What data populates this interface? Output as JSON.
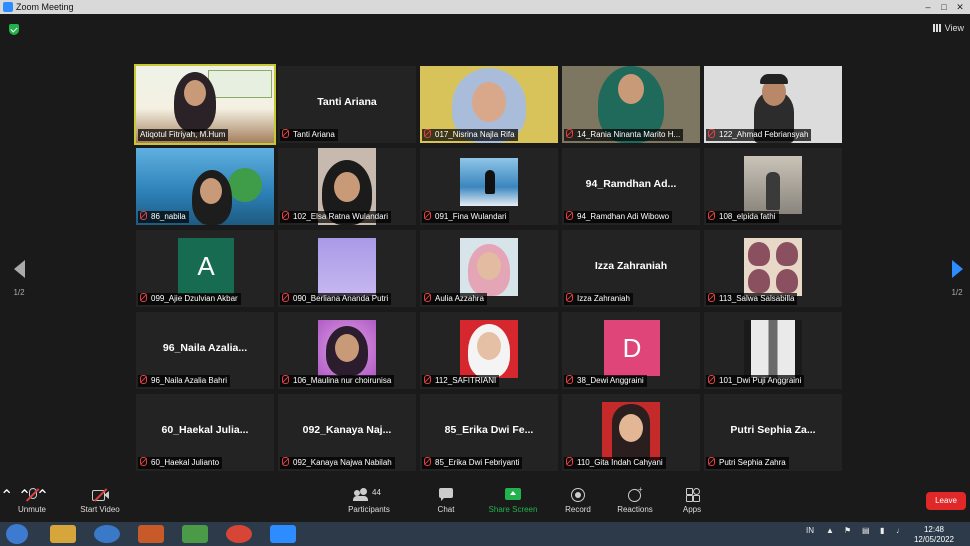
{
  "window": {
    "title": "Zoom Meeting"
  },
  "header": {
    "view_label": "View"
  },
  "pager": {
    "left": "1/2",
    "right": "1/2"
  },
  "tiles": [
    {
      "label": "Atiqotul Fitriyah, M.Hum",
      "type": "video"
    },
    {
      "label": "Tanti Ariana",
      "center": "Tanti Ariana",
      "type": "name"
    },
    {
      "label": "017_Nisrina Najla Rifa",
      "type": "video"
    },
    {
      "label": "14_Rania Ninanta Marito H...",
      "type": "video"
    },
    {
      "label": "122_Ahmad Febriansyah",
      "type": "video"
    },
    {
      "label": "86_nabila",
      "type": "video"
    },
    {
      "label": "102_Elsa Ratna Wulandari",
      "type": "video"
    },
    {
      "label": "091_Fina Wulandari",
      "type": "video"
    },
    {
      "label": "94_Ramdhan Adi Wibowo",
      "center": "94_Ramdhan  Ad...",
      "type": "name"
    },
    {
      "label": "108_elpida fathi",
      "type": "video"
    },
    {
      "label": "099_Ajie Dzulvian Akbar",
      "avatar": "A",
      "avatar_color": "#176b50",
      "type": "avatar"
    },
    {
      "label": "090_Berliana Ananda Putri",
      "type": "video"
    },
    {
      "label": "Aulia Azzahra",
      "type": "video"
    },
    {
      "label": "Izza Zahraniah",
      "center": "Izza Zahraniah",
      "type": "name"
    },
    {
      "label": "113_Salwa Salsabilla",
      "type": "video"
    },
    {
      "label": "96_Naila Azalia Bahri",
      "center": "96_Naila  Azalia...",
      "type": "name"
    },
    {
      "label": "106_Maulina nur choirunisa",
      "type": "video"
    },
    {
      "label": "112_SAFITRIANI",
      "type": "video"
    },
    {
      "label": "38_Dewi Anggraini",
      "avatar": "D",
      "avatar_color": "#e0457a",
      "type": "avatar"
    },
    {
      "label": "101_Dwi Puji Anggraini",
      "type": "video"
    },
    {
      "label": "60_Haekal Julianto",
      "center": "60_Haekal  Julia...",
      "type": "name"
    },
    {
      "label": "092_Kanaya Najwa Nabilah",
      "center": "092_Kanaya  Naj...",
      "type": "name"
    },
    {
      "label": "85_Erika Dwi Febriyanti",
      "center": "85_Erika  Dwi  Fe...",
      "type": "name"
    },
    {
      "label": "110_Gita Indah Cahyani",
      "type": "video"
    },
    {
      "label": "Putri Sephia Zahra",
      "center": "Putri  Sephia  Za...",
      "type": "name"
    }
  ],
  "toolbar": {
    "unmute": "Unmute",
    "start_video": "Start Video",
    "participants": "Participants",
    "participants_count": "44",
    "chat": "Chat",
    "share_screen": "Share Screen",
    "record": "Record",
    "reactions": "Reactions",
    "apps": "Apps",
    "leave": "Leave"
  },
  "taskbar": {
    "lang": "IN",
    "time": "12:48",
    "date": "12/05/2022"
  },
  "colors": {
    "share_green": "#23b14d",
    "leave_red": "#e02828",
    "active_border": "#c8c832",
    "zoom_blue": "#2d8cff"
  }
}
